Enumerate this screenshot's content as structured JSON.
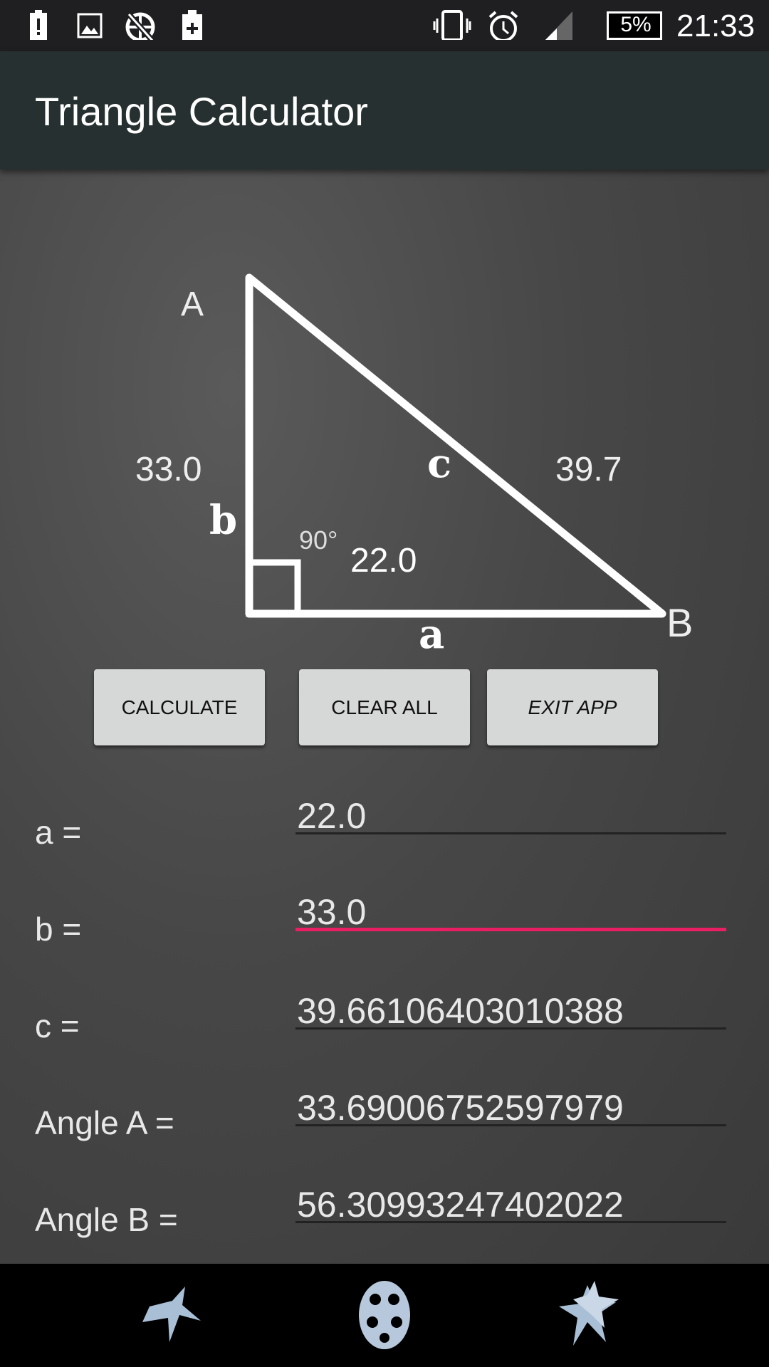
{
  "status_bar": {
    "time": "21:33",
    "battery": "5%",
    "icons": [
      "battery-alert-icon",
      "image-icon",
      "no-network-icon",
      "battery-charging-icon",
      "vibrate-icon",
      "alarm-icon",
      "signal-icon",
      "battery-icon"
    ]
  },
  "app_bar": {
    "title": "Triangle Calculator"
  },
  "diagram": {
    "vertex_a": "A",
    "vertex_b": "B",
    "side_a": "a",
    "side_b": "b",
    "side_c": "c",
    "right_angle": "90°",
    "value_a": "22.0",
    "value_b": "33.0",
    "value_c": "39.7"
  },
  "buttons": {
    "calculate": "CALCULATE",
    "clear": "CLEAR ALL",
    "exit": "EXIT APP"
  },
  "fields": [
    {
      "label": "a =",
      "value": "22.0"
    },
    {
      "label": "b =",
      "value": "33.0"
    },
    {
      "label": "c =",
      "value": "39.66106403010388"
    },
    {
      "label": "Angle A =",
      "value": "33.69006752597979"
    },
    {
      "label": "Angle B =",
      "value": "56.30993247402022"
    }
  ],
  "colors": {
    "accent": "#e91e63",
    "app_bar": "#263030",
    "status_bar": "#1f1f22"
  },
  "nav": {
    "icons": [
      "back-star-icon",
      "home-ball-icon",
      "recents-stars-icon"
    ]
  }
}
